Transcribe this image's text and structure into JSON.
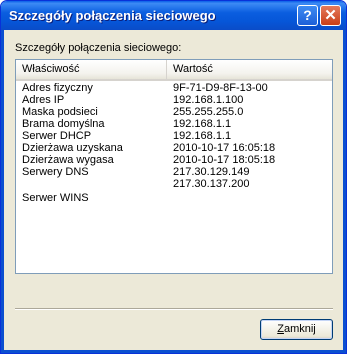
{
  "window": {
    "title": "Szczegóły połączenia sieciowego",
    "help_glyph": "?",
    "close_glyph": "✕"
  },
  "group_label": "Szczegóły połączenia sieciowego:",
  "table": {
    "headers": [
      "Właściwość",
      "Wartość"
    ],
    "rows": [
      {
        "key": "Adres fizyczny",
        "value": "9F-71-D9-8F-13-00"
      },
      {
        "key": "Adres IP",
        "value": "192.168.1.100"
      },
      {
        "key": "Maska podsieci",
        "value": "255.255.255.0"
      },
      {
        "key": "Brama domyślna",
        "value": "192.168.1.1"
      },
      {
        "key": "Serwer DHCP",
        "value": "192.168.1.1"
      },
      {
        "key": "Dzierżawa uzyskana",
        "value": "2010-10-17 16:05:18"
      },
      {
        "key": "Dzierżawa wygasa",
        "value": "2010-10-17 18:05:18"
      },
      {
        "key": "Serwery DNS",
        "value": "217.30.129.149"
      },
      {
        "key": "",
        "value": "217.30.137.200"
      },
      {
        "key": "Serwer WINS",
        "value": ""
      }
    ]
  },
  "buttons": {
    "close_label_first": "Z",
    "close_label_rest": "amknij"
  },
  "icons": {
    "help": "help-icon",
    "close": "close-icon"
  }
}
